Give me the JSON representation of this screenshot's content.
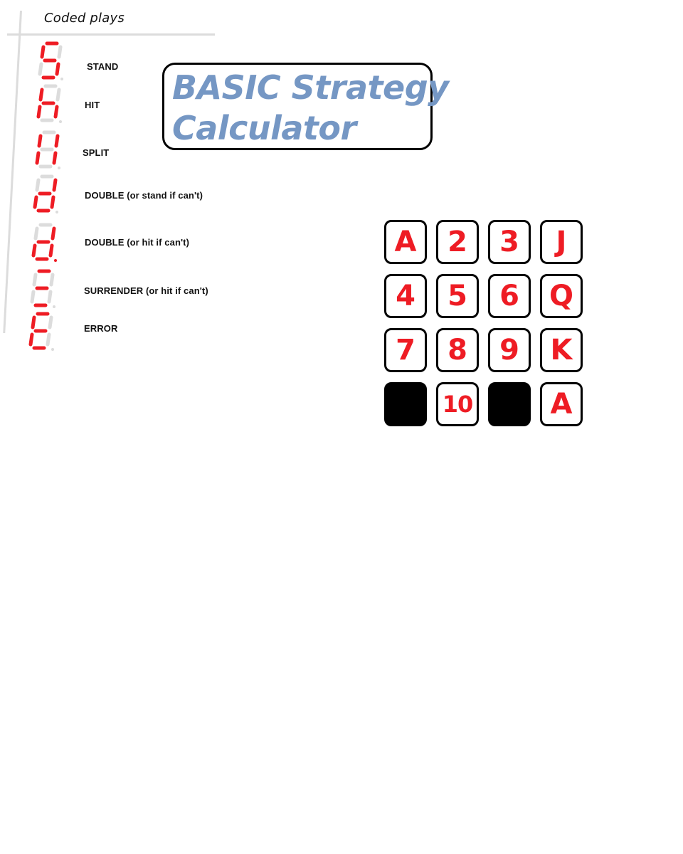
{
  "legend": {
    "title": "Coded plays",
    "items": [
      {
        "code": "S",
        "label": "STAND",
        "segments": [
          "a",
          "f",
          "g",
          "c",
          "d"
        ],
        "dot": false
      },
      {
        "code": "h",
        "label": "HIT",
        "segments": [
          "f",
          "g",
          "e",
          "c"
        ],
        "dot": false
      },
      {
        "code": "II",
        "label": "SPLIT",
        "segments": [
          "b",
          "c",
          "e",
          "f"
        ],
        "dot": false
      },
      {
        "code": "d",
        "label": "DOUBLE (or stand if can't)",
        "segments": [
          "b",
          "c",
          "d",
          "e",
          "g"
        ],
        "dot": false
      },
      {
        "code": "d.",
        "label": "DOUBLE (or hit if can't)",
        "segments": [
          "b",
          "c",
          "d",
          "e",
          "g"
        ],
        "dot": true
      },
      {
        "code": "≡",
        "label": "SURRENDER (or hit if can't)",
        "segments": [
          "a",
          "g",
          "d"
        ],
        "dot": false
      },
      {
        "code": "E",
        "label": "ERROR",
        "segments": [
          "a",
          "f",
          "g",
          "e",
          "d"
        ],
        "dot": false
      }
    ]
  },
  "title": {
    "line1": "BASIC Strategy",
    "line2": "Calculator"
  },
  "keypad": {
    "keys": [
      {
        "label": "A"
      },
      {
        "label": "2"
      },
      {
        "label": "3"
      },
      {
        "label": "J"
      },
      {
        "label": "4"
      },
      {
        "label": "5"
      },
      {
        "label": "6"
      },
      {
        "label": "Q"
      },
      {
        "label": "7"
      },
      {
        "label": "8"
      },
      {
        "label": "9"
      },
      {
        "label": "K"
      },
      {
        "label": "",
        "blank": true
      },
      {
        "label": "10"
      },
      {
        "label": "",
        "blank": true
      },
      {
        "label": "A"
      }
    ]
  },
  "colors": {
    "segment_on": "#ee1c24",
    "segment_off": "#dcdcdc",
    "title_text": "#7597c4",
    "key_text": "#ee1c24"
  }
}
